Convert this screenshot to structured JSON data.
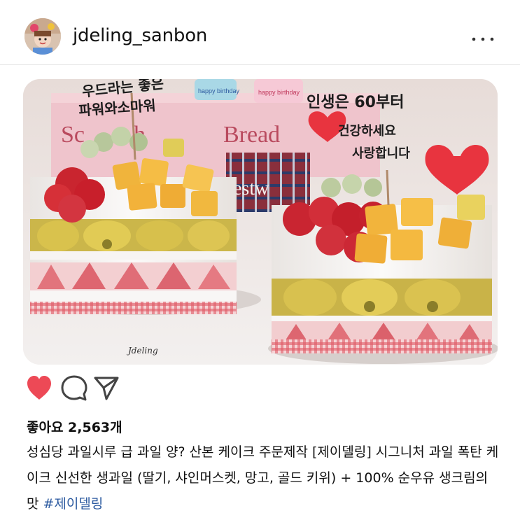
{
  "post": {
    "username": "jdeling_sanbon",
    "likes_text": "좋아요 2,563개",
    "caption": "성심당 과일시루 급 과일 양? 산본 케이크 주문제작 [제이델링] 시그니처 과일 폭탄 케이크 신선한 생과일 (딸기, 샤인머스켓, 망고, 골드 키위) + 100% 순우유 생크림의 맛 ",
    "hashtag": "#제이델링"
  },
  "photo": {
    "box_text": "Bread",
    "box_text_partial": "Sc",
    "box_text_mid": "h",
    "topper_left_line1": "우드라는 좋은",
    "topper_left_line2": "파워와소마워",
    "topper_right_line1": "인생은 60부터",
    "topper_right_line2": "건강하세요",
    "topper_right_line3": "사랑합니다",
    "plate_text": "Jdeling",
    "sign_left": "happy birthday",
    "sign_right": "happy birthday",
    "tin_text": "estw"
  },
  "icons": {
    "more": "more-options-icon",
    "like": "heart-icon",
    "comment": "comment-icon",
    "share": "send-icon"
  },
  "colors": {
    "like_red": "#ed4956",
    "hashtag_blue": "#2c5aa0"
  }
}
